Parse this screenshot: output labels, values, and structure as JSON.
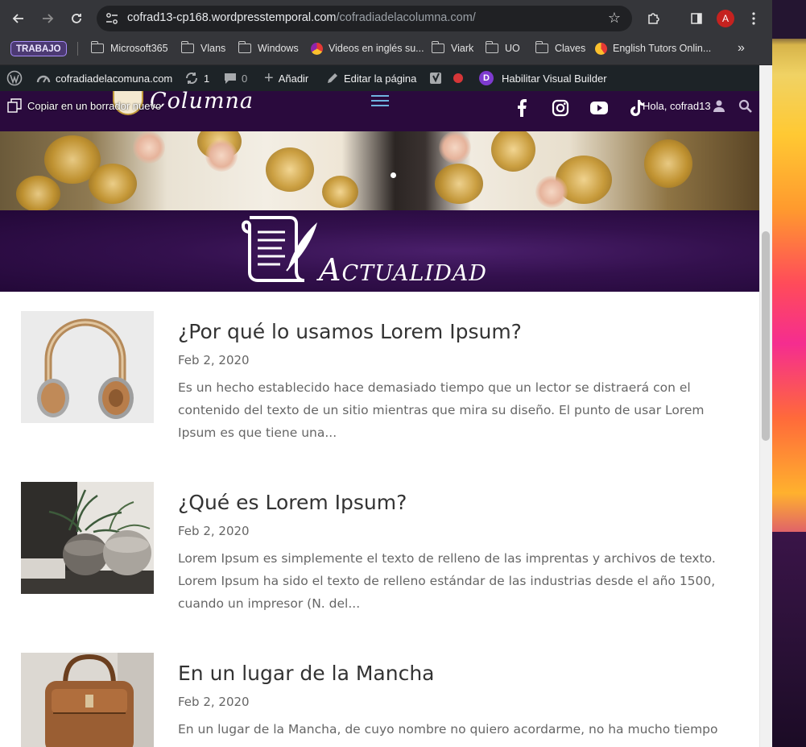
{
  "browser": {
    "url_host": "cofrad13-cp168.wordpresstemporal.com",
    "url_path": "/cofradiadelacolumna.com/",
    "profile_initial": "A"
  },
  "bookmarks": {
    "group_chip": "TRABAJO",
    "items": [
      {
        "label": "Microsoft365",
        "icon": "folder-icon"
      },
      {
        "label": "Vlans",
        "icon": "folder-icon"
      },
      {
        "label": "Windows",
        "icon": "folder-icon"
      },
      {
        "label": "Videos en inglés su...",
        "icon": "site-favicon"
      },
      {
        "label": "Viark",
        "icon": "folder-icon"
      },
      {
        "label": "UO",
        "icon": "folder-icon"
      },
      {
        "label": "Claves",
        "icon": "folder-icon"
      },
      {
        "label": "English Tutors Onlin...",
        "icon": "site-favicon"
      }
    ],
    "overflow": "»"
  },
  "adminbar": {
    "site_name": "cofradiadelacomuna.com",
    "updates_count": "1",
    "comments_count": "0",
    "add_new": "Añadir",
    "edit_page": "Editar la página",
    "visual_builder": "Habilitar Visual Builder",
    "divi_badge": "D"
  },
  "site_header": {
    "logo_text": "Columna",
    "copy_draft": "Copiar en un borrador nuevo",
    "greeting": "Hola, cofrad13",
    "social": [
      "facebook-icon",
      "instagram-icon",
      "youtube-icon",
      "tiktok-icon"
    ]
  },
  "banner": {
    "title": "Actualidad"
  },
  "posts": [
    {
      "title": "¿Por qué lo usamos Lorem Ipsum?",
      "date": "Feb 2, 2020",
      "excerpt": "Es un hecho establecido hace demasiado tiempo que un lector se distraerá con el contenido del texto de un sitio mientras que mira su diseño. El punto de usar Lorem Ipsum es que tiene una..."
    },
    {
      "title": "¿Qué es Lorem Ipsum?",
      "date": "Feb 2, 2020",
      "excerpt": "Lorem Ipsum es simplemente el texto de relleno de las imprentas y archivos de texto. Lorem Ipsum ha sido el texto de relleno estándar de las industrias desde el año 1500, cuando un impresor (N. del..."
    },
    {
      "title": "En un lugar de la Mancha",
      "date": "Feb 2, 2020",
      "excerpt": "En un lugar de la Mancha, de cuyo nombre no quiero acordarme, no ha mucho tiempo"
    }
  ],
  "colors": {
    "admin_bar": "#1d2327",
    "header_purple": "#2a0a3d",
    "banner_purple": "#33104d",
    "divi_purple": "#7e3bd0",
    "record_red": "#d63638"
  }
}
